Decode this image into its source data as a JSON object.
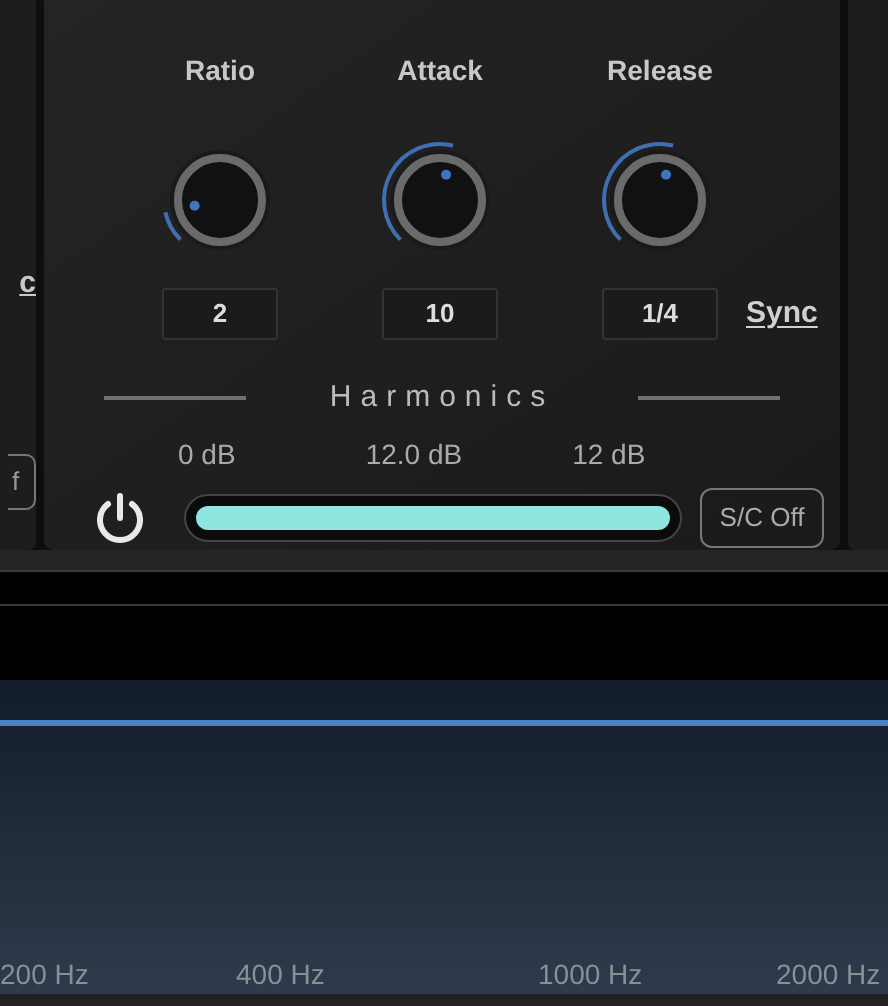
{
  "left_panel": {
    "sync_label": "c",
    "sc_button": "f"
  },
  "knobs": [
    {
      "label": "Ratio",
      "value": "2"
    },
    {
      "label": "Attack",
      "value": "10"
    },
    {
      "label": "Release",
      "value": "1/4"
    }
  ],
  "sync_link": "Sync",
  "harmonics": {
    "title": "Harmonics",
    "min_label": "0 dB",
    "value_label": "12.0 dB",
    "max_label": "12 dB",
    "level": 1.0,
    "on": true,
    "sc_button": "S/C Off"
  },
  "spectrum": {
    "freq_labels": [
      "200 Hz",
      "400 Hz",
      "1000 Hz",
      "2000 Hz"
    ]
  }
}
